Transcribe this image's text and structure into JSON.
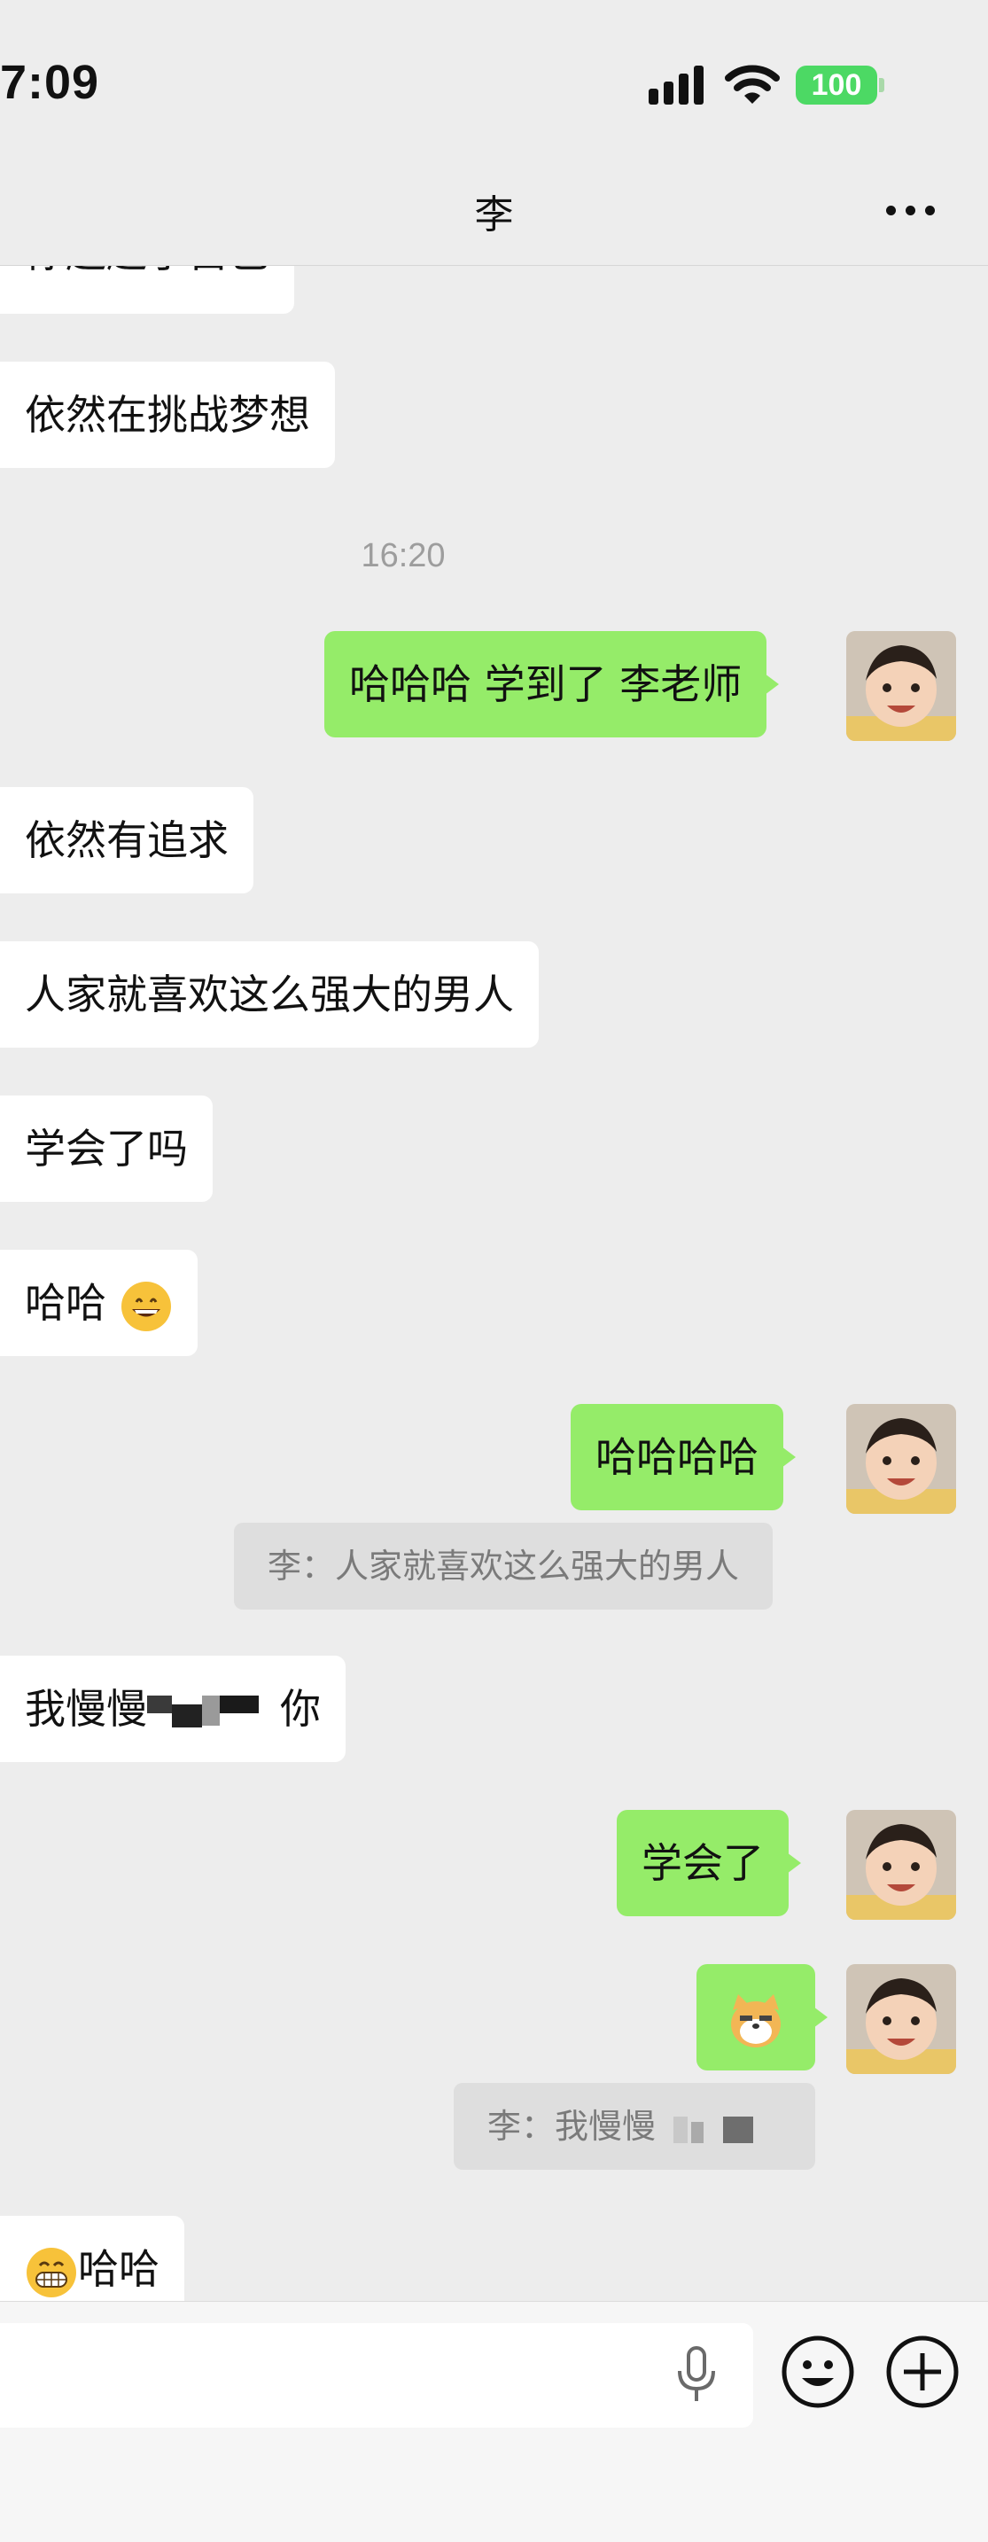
{
  "status_bar": {
    "time": "7:09",
    "battery": "100",
    "icons": [
      "cellular-signal-icon",
      "wifi-icon",
      "battery-icon"
    ]
  },
  "header": {
    "title": "李",
    "more_icon": "more-icon"
  },
  "messages": {
    "m0_text": "你超越了自己",
    "m1_text": "依然在挑战梦想",
    "ts_text": "16:20",
    "m2_text": "哈哈哈 学到了 李老师",
    "m3_text": "依然有追求",
    "m4_text": "人家就喜欢这么强大的男人",
    "m5_text": "学会了吗",
    "m6_text": "哈哈",
    "m6_emoji": "grinning-face-icon",
    "m7_text": "哈哈哈哈",
    "q1_text": "李：人家就喜欢这么强大的男人",
    "m8_prefix": "我慢慢",
    "m8_suffix": "你",
    "m9_text": "学会了",
    "m10_sticker": "cat-emoji-icon",
    "q2_text": "李：我慢慢",
    "m11_emoji": "grinning-teeth-icon",
    "m11_text": "哈哈"
  },
  "input_bar": {
    "voice_icon": "microphone-icon",
    "emoji_icon": "smiley-icon",
    "plus_icon": "plus-icon"
  },
  "colors": {
    "background": "#ededed",
    "sent_bubble": "#95ec69",
    "received_bubble": "#ffffff",
    "battery": "#4cd964"
  }
}
